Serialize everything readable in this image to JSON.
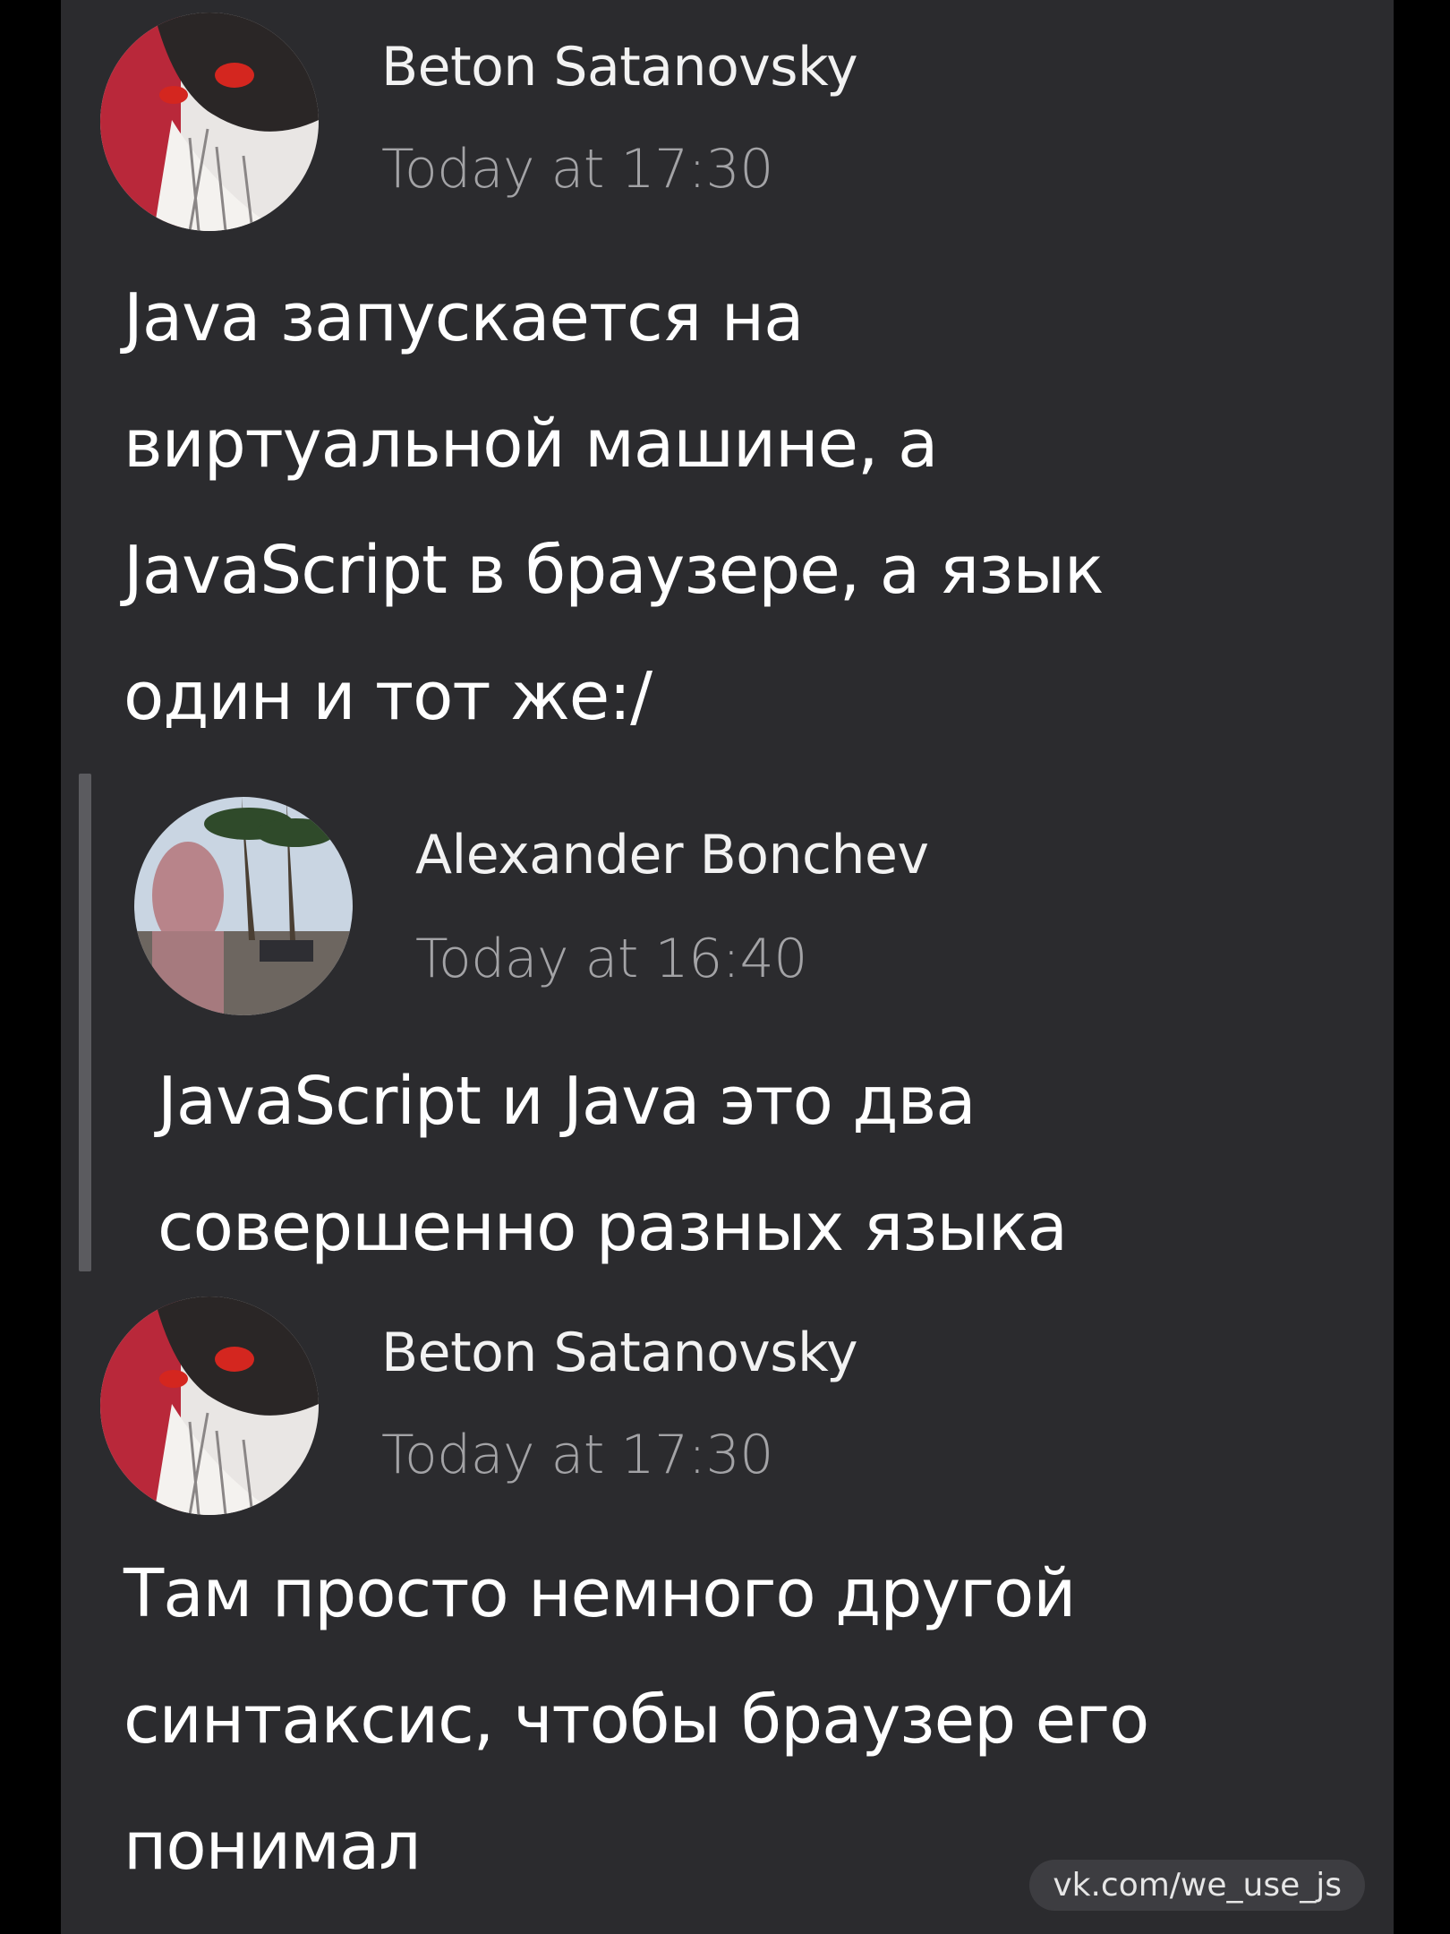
{
  "messages": [
    {
      "author": "Beton Satanovsky",
      "time": "Today at 17:30",
      "lines": [
        "Java запускается на",
        "виртуальной машине, а",
        "JavaScript в браузере, а язык",
        "один и тот же:/"
      ]
    },
    {
      "author": "Alexander Bonchev",
      "time": "Today at 16:40",
      "lines": [
        "JavaScript и Java это два",
        "совершенно разных языка"
      ]
    },
    {
      "author": "Beton Satanovsky",
      "time": "Today at 17:30",
      "lines": [
        "Там просто немного другой",
        "синтаксис, чтобы браузер его",
        "понимал"
      ]
    }
  ],
  "watermark": "vk.com/we_use_js",
  "colors": {
    "background": "#2b2b2e",
    "text": "#ffffff",
    "timestamp": "#a3a3a6",
    "quote_bar": "#5b5b5f"
  }
}
